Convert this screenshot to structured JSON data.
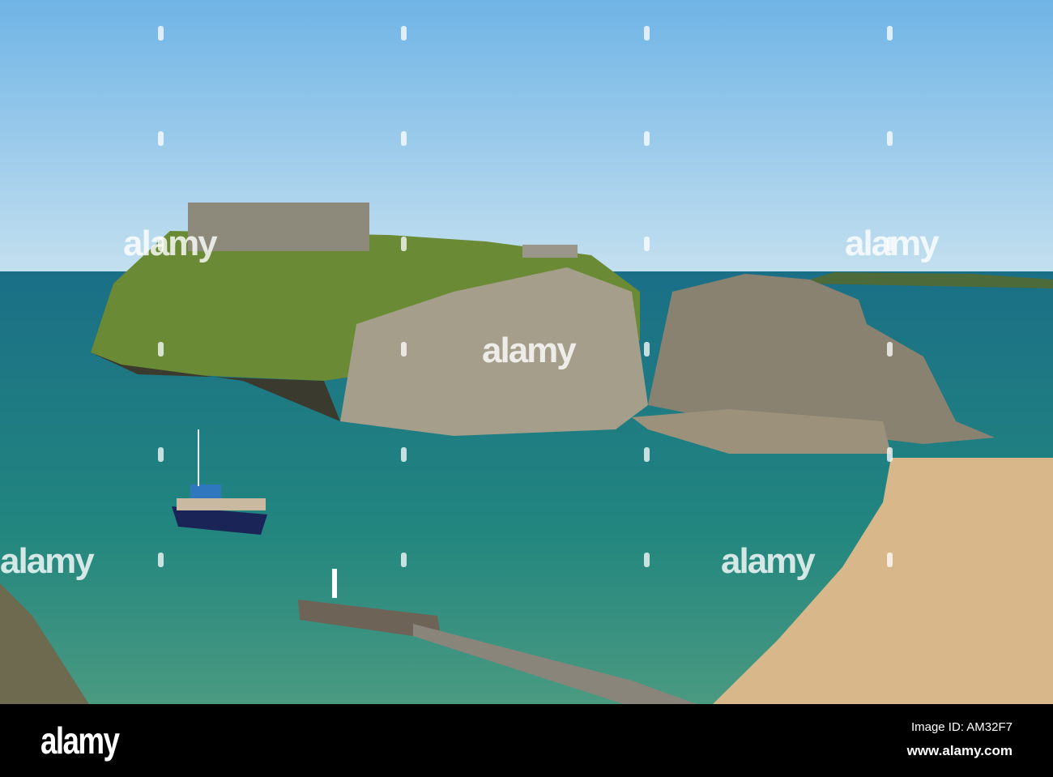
{
  "watermark": {
    "text": "alamy"
  },
  "footer": {
    "logo": "alamy",
    "image_id": "Image ID: AM32F7",
    "url": "www.alamy.com"
  },
  "colors": {
    "sky_top": "#6fb4e6",
    "sky_bottom": "#c4e0ef",
    "sea": "#1f7f86",
    "sand": "#d8b88a",
    "grass": "#6a8a35",
    "rock": "#6e6a5a"
  }
}
